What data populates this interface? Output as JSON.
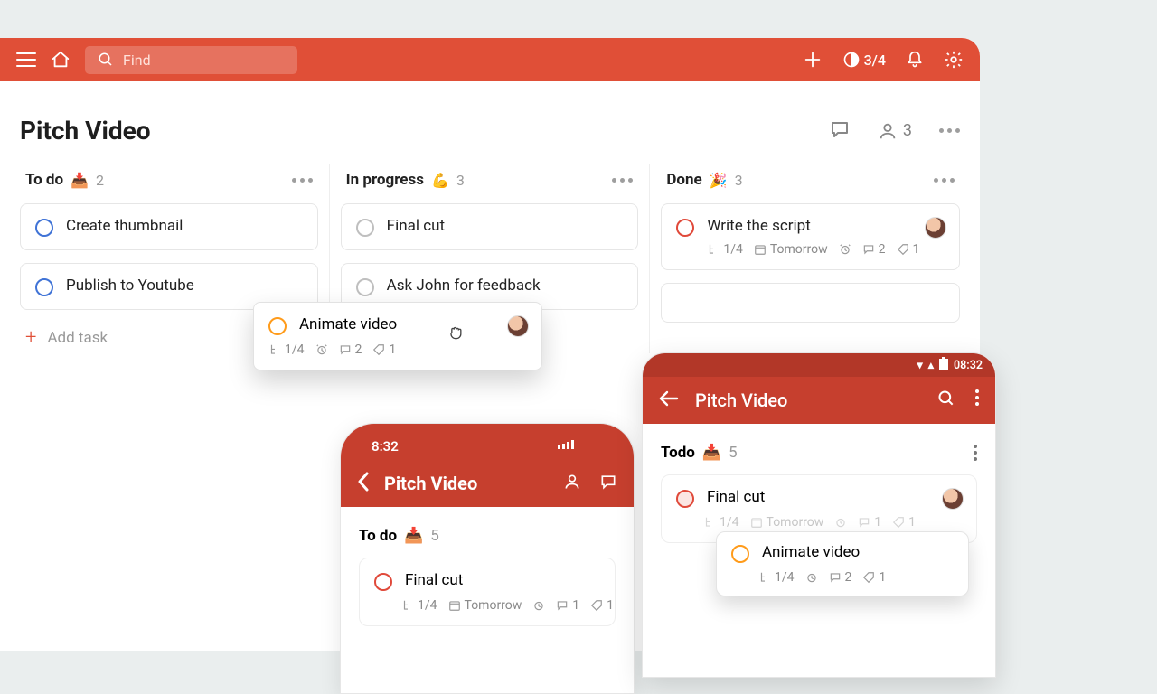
{
  "topbar": {
    "search_placeholder": "Find",
    "progress": "3/4"
  },
  "project": {
    "title": "Pitch Video",
    "members": "3"
  },
  "columns": {
    "todo": {
      "title": "To do",
      "emoji": "📥",
      "count": "2"
    },
    "doing": {
      "title": "In progress",
      "emoji": "💪",
      "count": "3"
    },
    "done": {
      "title": "Done",
      "emoji": "🎉",
      "count": "3"
    }
  },
  "tasks": {
    "thumb": {
      "title": "Create thumbnail"
    },
    "publish": {
      "title": "Publish to Youtube"
    },
    "final": {
      "title": "Final cut"
    },
    "ask": {
      "title": "Ask John for feedback"
    },
    "script": {
      "title": "Write the script",
      "sub": "1/4",
      "due": "Tomorrow",
      "comments": "2",
      "likes": "1"
    },
    "anim": {
      "title": "Animate video",
      "sub": "1/4",
      "comments": "2",
      "likes": "1"
    }
  },
  "add_task_label": "Add task",
  "ios": {
    "time": "8:32",
    "title": "Pitch Video",
    "section": "To do",
    "section_emoji": "📥",
    "section_count": "5",
    "card_title": "Final cut",
    "sub": "1/4",
    "due": "Tomorrow",
    "comments": "1",
    "likes": "1"
  },
  "android": {
    "time": "08:32",
    "title": "Pitch Video",
    "section": "Todo",
    "section_emoji": "📥",
    "section_count": "5",
    "card_title": "Final cut",
    "sub": "1/4",
    "due": "Tomorrow",
    "comments": "1",
    "likes": "1",
    "float_title": "Animate video",
    "float_sub": "1/4",
    "float_comments": "2",
    "float_likes": "1"
  }
}
